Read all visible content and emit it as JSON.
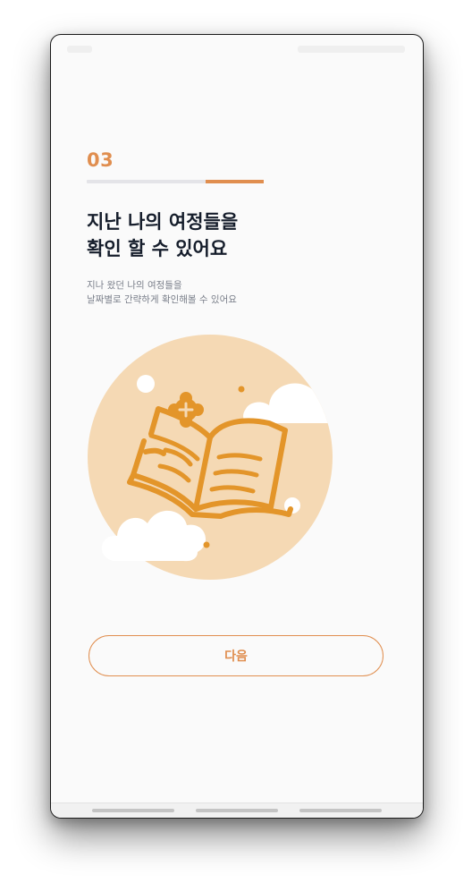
{
  "onboarding": {
    "step_number": "03",
    "progress": {
      "segment_start": 0.67,
      "segment_end": 1.0
    },
    "headline_line1": "지난 나의 여정들을",
    "headline_line2": "확인 할 수 있어요",
    "subtext_line1": "지나 왔던 나의 여정들을",
    "subtext_line2": "날짜별로 간략하게 확인해볼 수 있어요",
    "illustration_icon": "open-book-icon",
    "next_button_label": "다음"
  },
  "colors": {
    "accent": "#e08e4f",
    "illustration_bg": "#f5d9b4",
    "book_stroke": "#e3952a",
    "headline": "#151d2b",
    "subtext": "#7a7f8a"
  },
  "system_nav": {
    "buttons": [
      "back",
      "home",
      "recents"
    ]
  }
}
